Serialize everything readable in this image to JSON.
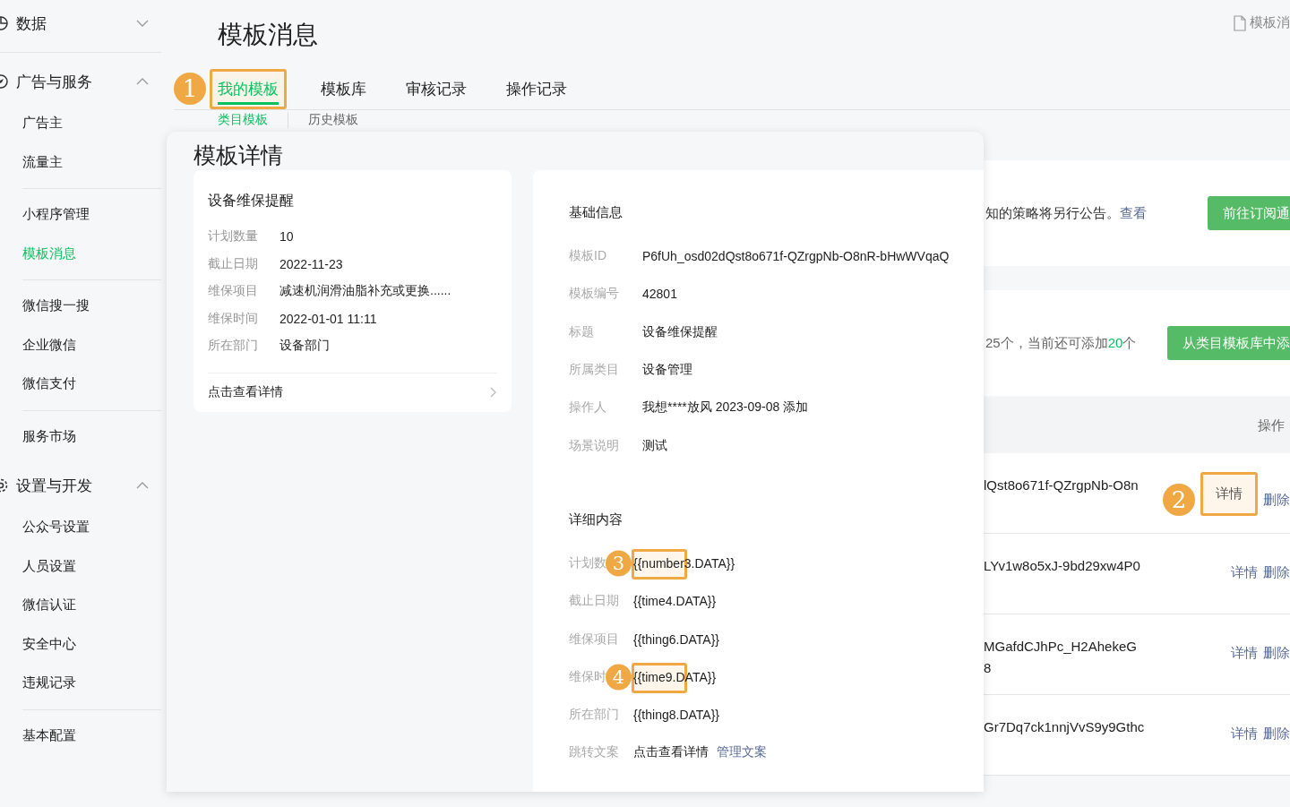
{
  "sidebar": {
    "groups": [
      {
        "label": "数据",
        "expanded": false
      },
      {
        "label": "广告与服务",
        "expanded": true,
        "sections": [
          [
            {
              "label": "广告主",
              "selected": false
            },
            {
              "label": "流量主",
              "selected": false
            }
          ],
          [
            {
              "label": "小程序管理",
              "selected": false
            },
            {
              "label": "模板消息",
              "selected": true
            }
          ],
          [
            {
              "label": "微信搜一搜",
              "selected": false
            },
            {
              "label": "企业微信",
              "selected": false
            },
            {
              "label": "微信支付",
              "selected": false
            }
          ],
          [
            {
              "label": "服务市场",
              "selected": false
            }
          ]
        ]
      },
      {
        "label": "设置与开发",
        "expanded": true,
        "sections": [
          [
            {
              "label": "公众号设置",
              "selected": false
            },
            {
              "label": "人员设置",
              "selected": false
            },
            {
              "label": "微信认证",
              "selected": false
            },
            {
              "label": "安全中心",
              "selected": false
            },
            {
              "label": "违规记录",
              "selected": false
            }
          ],
          [
            {
              "label": "基本配置",
              "selected": false
            }
          ]
        ]
      }
    ]
  },
  "page": {
    "title": "模板消息",
    "doc_link": "模板消",
    "tabs": [
      {
        "label": "我的模板",
        "selected": true,
        "marker": "1"
      },
      {
        "label": "模板库",
        "selected": false
      },
      {
        "label": "审核记录",
        "selected": false
      },
      {
        "label": "操作记录",
        "selected": false
      }
    ],
    "subtabs": [
      {
        "label": "类目模板",
        "selected": true
      },
      {
        "label": "历史模板",
        "selected": false
      }
    ],
    "notice": {
      "text": "知的策略将另行公告。",
      "link": "查看",
      "button": "前往订阅通"
    },
    "quota": {
      "text": "25个，当前还可添加",
      "count": "20",
      "unit": "个",
      "button": "从类目模板库中添"
    },
    "table": {
      "columns": [
        "操作"
      ],
      "rows": [
        {
          "id": [
            "lQst8o671f-QZrgpNb-O8n"
          ],
          "detail": "详情",
          "delete": "删除",
          "marker": "2"
        },
        {
          "id": [
            "LYv1w8o5xJ-9bd29xw4P0"
          ],
          "detail": "详情",
          "delete": "删除"
        },
        {
          "id": [
            "MGafdCJhPc_H2AhekeG",
            "8"
          ],
          "detail": "详情",
          "delete": "删除"
        },
        {
          "id": [
            "Gr7Dq7ck1nnjVvS9y9Gthc"
          ],
          "detail": "详情",
          "delete": "删除"
        }
      ]
    }
  },
  "modal": {
    "title": "模板详情",
    "preview": {
      "title": "设备维保提醒",
      "fields": [
        {
          "label": "计划数量",
          "value": "10"
        },
        {
          "label": "截止日期",
          "value": "2022-11-23"
        },
        {
          "label": "维保项目",
          "value": "减速机润滑油脂补充或更换......"
        },
        {
          "label": "维保时间",
          "value": "2022-01-01 11:11"
        },
        {
          "label": "所在部门",
          "value": "设备部门"
        }
      ],
      "footer": "点击查看详情"
    },
    "sections": [
      {
        "title": "基础信息",
        "fields": [
          {
            "label": "模板ID",
            "value": "P6fUh_osd02dQst8o671f-QZrgpNb-O8nR-bHwWVqaQ"
          },
          {
            "label": "模板编号",
            "value": "42801"
          },
          {
            "label": "标题",
            "value": "设备维保提醒"
          },
          {
            "label": "所属类目",
            "value": "设备管理"
          },
          {
            "label": "操作人",
            "value": "我想****放风 2023-09-08 添加"
          },
          {
            "label": "场景说明",
            "value": "测试"
          }
        ]
      },
      {
        "title": "详细内容",
        "fields": [
          {
            "label": "计划数",
            "value": "{{number3.DATA}}",
            "marker": "3"
          },
          {
            "label": "截止日期",
            "value": "{{time4.DATA}}"
          },
          {
            "label": "维保项目",
            "value": "{{thing6.DATA}}"
          },
          {
            "label": "维保时",
            "value": "{{time9.DATA}}",
            "marker": "4"
          },
          {
            "label": "所在部门",
            "value": "{{thing8.DATA}}"
          },
          {
            "label": "跳转文案",
            "value": "点击查看详情",
            "link": "管理文案"
          }
        ]
      }
    ]
  }
}
